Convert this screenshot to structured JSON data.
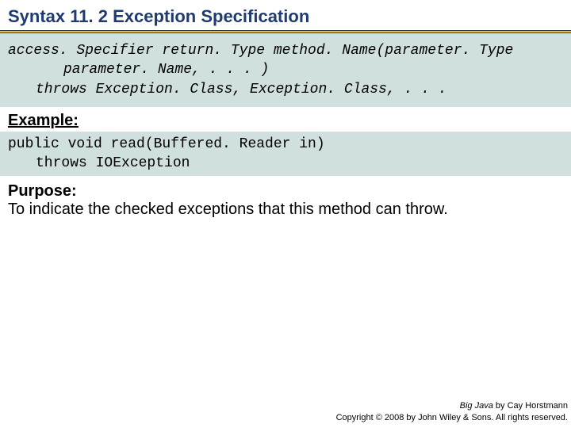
{
  "title": "Syntax 11. 2 Exception Specification",
  "syntax": {
    "line1": "access. Specifier return. Type method. Name(parameter. Type",
    "line2": "parameter. Name, . . . )",
    "line3": "throws Exception. Class, Exception. Class, . . ."
  },
  "example_label": "Example:",
  "example": {
    "line1": "public void read(Buffered. Reader in)",
    "line2": "throws IOException"
  },
  "purpose_label": "Purpose:",
  "purpose_body": "To indicate the checked exceptions that this method can throw.",
  "footer": {
    "book": "Big Java",
    "author": " by Cay Horstmann",
    "copyright": "Copyright © 2008 by John Wiley & Sons.  All rights reserved."
  }
}
